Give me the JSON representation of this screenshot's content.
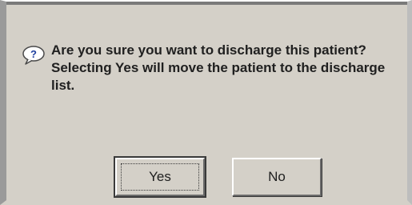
{
  "dialog": {
    "icon": "question-icon",
    "message_line1": "Are you sure you want to discharge this patient?",
    "message_line2": "Selecting Yes will move the patient to the discharge list.",
    "buttons": {
      "yes_label": "Yes",
      "no_label": "No"
    }
  }
}
